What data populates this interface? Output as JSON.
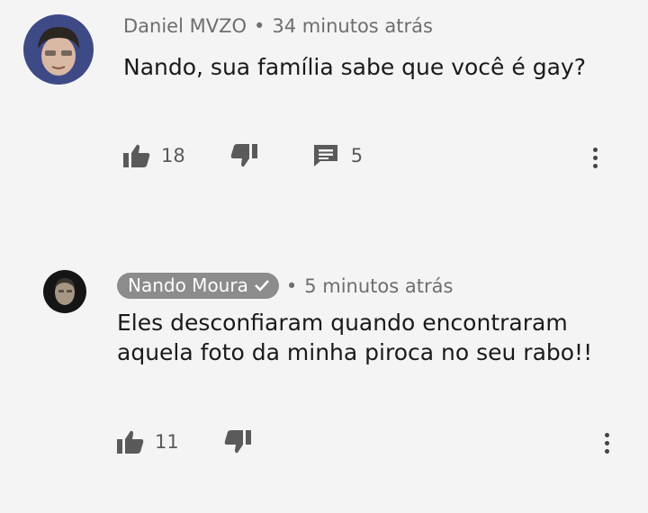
{
  "comments": [
    {
      "author": "Daniel MVZO",
      "time": "34 minutos atrás",
      "separator": "•",
      "text": "Nando, sua família sabe que você é gay?",
      "likes": "18",
      "replies": "5",
      "avatar_icon": "user-avatar-icon"
    },
    {
      "author": "Nando Moura",
      "verified": true,
      "time": "5 minutos atrás",
      "separator": "•",
      "text": "Eles desconfiaram quando encontraram aquela foto da minha piroca no seu rabo!!",
      "likes": "11",
      "avatar_icon": "user-avatar-icon"
    }
  ],
  "colors": {
    "background": "#f4f4f4",
    "text": "#1a1a1a",
    "meta": "#6e6e6e",
    "chip": "#8c8c8c",
    "icon": "#5a5a5a"
  },
  "icons": [
    "thumbs-up-icon",
    "thumbs-down-icon",
    "reply-icon",
    "more-vert-icon",
    "check-icon"
  ]
}
